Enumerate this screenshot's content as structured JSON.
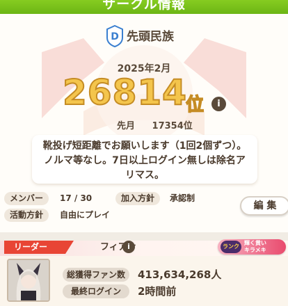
{
  "header": {
    "title": "サークル情報"
  },
  "circle": {
    "name": "先頭民族",
    "month": "2025年2月",
    "rank": "26814",
    "rank_suffix": "位",
    "prev_label": "先月",
    "prev_value": "17354位",
    "description": "靴投げ短距離でお願いします（1回2個ずつ）。ノルマ等なし。7日以上ログイン無しは除名アリマス。"
  },
  "fields": {
    "member_label": "メンバー",
    "member_value": "17 / 30",
    "join_label": "加入方針",
    "join_value": "承認制",
    "policy_label": "活動方針",
    "policy_value": "自由にプレイ"
  },
  "edit_button": "編 集",
  "leader": {
    "tag": "リーダー",
    "name": "フィアナ",
    "badge_text_1": "輝く黄い",
    "badge_text_2": "キラメキ",
    "badge_rank": "ランク",
    "fans_label": "総獲得ファン数",
    "fans_value": "413,634,268人",
    "login_label": "最終ログイン",
    "login_value": "2時間前"
  },
  "colors": {
    "header": "#7cc21b",
    "rank_gold": "#f4c54c",
    "leader_tag": "#e84535"
  }
}
